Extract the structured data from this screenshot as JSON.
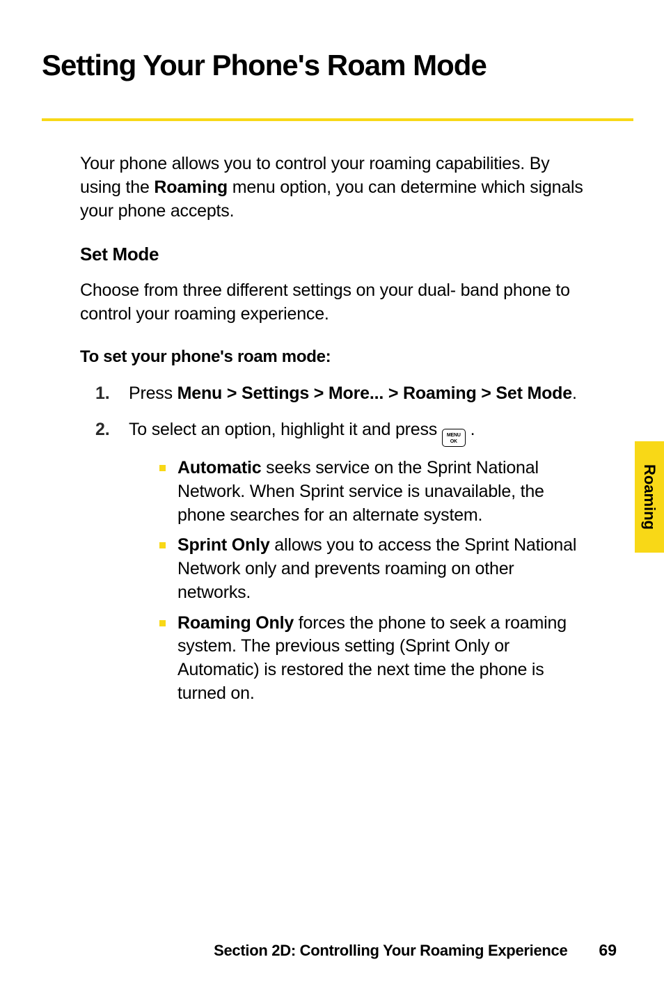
{
  "heading": "Setting Your Phone's Roam Mode",
  "intro_pre": "Your phone allows you to control your roaming capabilities. By using the ",
  "intro_bold": "Roaming",
  "intro_post": " menu option, you can determine which signals your phone accepts.",
  "subhead": "Set Mode",
  "para2": "Choose from three different settings on your dual- band phone to control your roaming experience.",
  "lead": "To set your phone's roam mode:",
  "step1_num": "1.",
  "step1_pre": "Press ",
  "step1_bold": "Menu > Settings > More... > Roaming > Set Mode",
  "step1_post": ".",
  "step2_num": "2.",
  "step2_pre": "To select an option, highlight it and press ",
  "step2_post": " .",
  "key_top": "MENU",
  "key_bot": "OK",
  "bullet1_bold": "Automatic",
  "bullet1_text": " seeks service on the Sprint National Network. When Sprint service is unavailable, the phone searches for an alternate system.",
  "bullet2_bold": "Sprint Only",
  "bullet2_text": " allows you to access the Sprint National Network only and prevents roaming on other networks.",
  "bullet3_bold": "Roaming Only",
  "bullet3_text": " forces the phone to seek a roaming system. The previous setting (Sprint Only or Automatic) is restored the next time the phone is turned on.",
  "side_tab": "Roaming",
  "footer_text": "Section 2D: Controlling Your Roaming Experience",
  "footer_page": "69"
}
